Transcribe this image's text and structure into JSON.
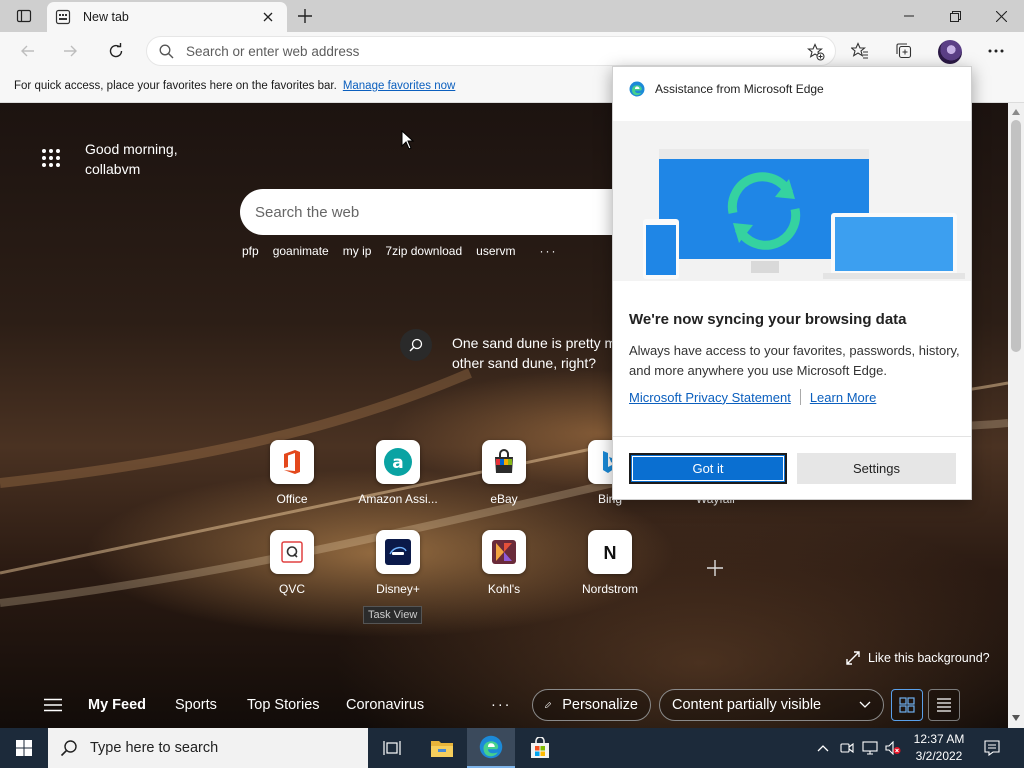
{
  "browser": {
    "tab_title": "New tab",
    "address_placeholder": "Search or enter web address",
    "favorites_bar_text": "For quick access, place your favorites here on the favorites bar.",
    "favorites_bar_link": "Manage favorites now"
  },
  "newtab": {
    "greeting_line1": "Good morning,",
    "greeting_line2": "collabvm",
    "search_placeholder": "Search the web",
    "quick_links": [
      "pfp",
      "goanimate",
      "my ip",
      "7zip download",
      "uservm"
    ],
    "quick_links_more": "···",
    "image_caption_line1": "One sand dune is pretty m",
    "image_caption_line2": "other sand dune, right?",
    "top_sites_row1": [
      {
        "label": "Office",
        "icon": "office-icon"
      },
      {
        "label": "Amazon Assi...",
        "icon": "amazon-assistant-icon"
      },
      {
        "label": "eBay",
        "icon": "ebay-icon"
      },
      {
        "label": "Bing",
        "icon": "bing-icon"
      },
      {
        "label": "Wayfair",
        "icon": "wayfair-icon"
      }
    ],
    "top_sites_row2": [
      {
        "label": "QVC",
        "icon": "qvc-icon"
      },
      {
        "label": "Disney+",
        "icon": "disney-plus-icon"
      },
      {
        "label": "Kohl's",
        "icon": "kohls-icon"
      },
      {
        "label": "Nordstrom",
        "icon": "nordstrom-icon"
      }
    ],
    "like_background": "Like this background?",
    "feed_tabs": [
      "My Feed",
      "Sports",
      "Top Stories",
      "Coronavirus"
    ],
    "feed_more": "···",
    "personalize": "Personalize",
    "content_visibility": "Content partially visible",
    "tooltip": "Task View"
  },
  "popup": {
    "header": "Assistance from Microsoft Edge",
    "title": "We're now syncing your browsing data",
    "body": "Always have access to your favorites, passwords, history, and more anywhere you use Microsoft Edge.",
    "link_privacy": "Microsoft Privacy Statement",
    "link_learn": "Learn More",
    "btn_primary": "Got it",
    "btn_secondary": "Settings"
  },
  "taskbar": {
    "search_placeholder": "Type here to search",
    "time": "12:37 AM",
    "date": "3/2/2022"
  },
  "colors": {
    "edge_blue": "#0a6fd1",
    "link_blue": "#0b5fbe",
    "taskbar": "#1c2a3a"
  }
}
